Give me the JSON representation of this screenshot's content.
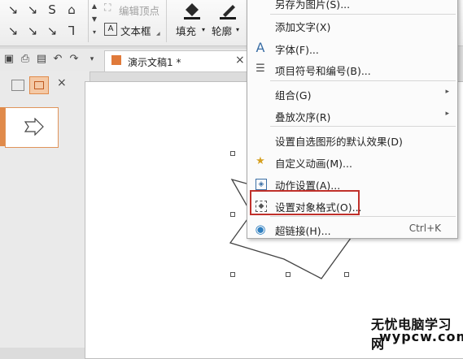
{
  "ribbon": {
    "edit_vertex_label": "编辑顶点",
    "textbox_label": "文本框",
    "fill_label": "填充",
    "outline_label": "轮廓"
  },
  "tab": {
    "doc_title": "演示文稿1 *",
    "close": "×"
  },
  "menu": {
    "items": [
      {
        "label": "另存为图片(S)...",
        "icon": ""
      },
      {
        "label": "添加文字(X)",
        "icon": ""
      },
      {
        "label": "字体(F)...",
        "icon": "font-A-icon"
      },
      {
        "label": "项目符号和编号(B)...",
        "icon": "bullet-list-icon"
      },
      {
        "label": "组合(G)",
        "icon": "",
        "submenu": "▸"
      },
      {
        "label": "叠放次序(R)",
        "icon": "",
        "submenu": "▸"
      },
      {
        "label": "设置自选图形的默认效果(D)",
        "icon": ""
      },
      {
        "label": "自定义动画(M)...",
        "icon": "star-animation-icon"
      },
      {
        "label": "动作设置(A)...",
        "icon": "action-icon"
      },
      {
        "label": "设置对象格式(O)...",
        "icon": "format-object-icon"
      },
      {
        "label": "超链接(H)...",
        "icon": "hyperlink-icon",
        "shortcut": "Ctrl+K"
      }
    ],
    "highlight_color": "#c0302a"
  },
  "watermark": {
    "line1": "无忧电脑学习网",
    "line2": "wypcw.com"
  },
  "colors": {
    "accent_orange": "#e08a4a",
    "shape_fill": "#ffffff",
    "shape_stroke": "#555555"
  }
}
